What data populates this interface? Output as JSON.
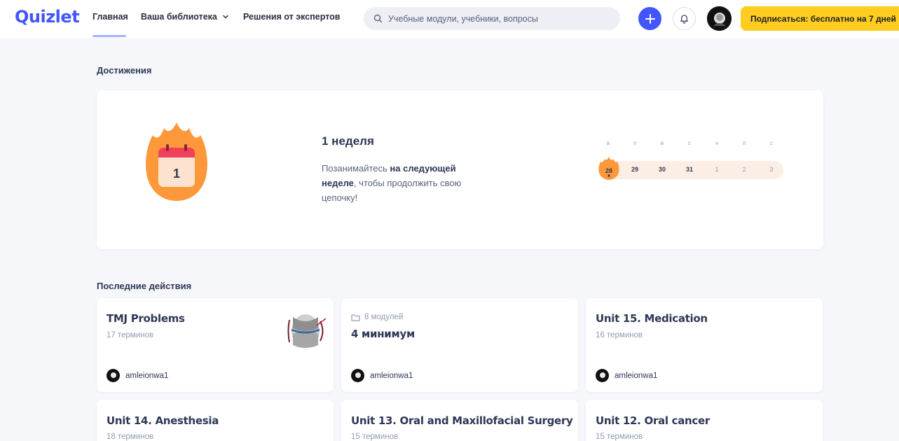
{
  "header": {
    "logo": "Quizlet",
    "nav": {
      "home": "Главная",
      "library": "Ваша библиотека",
      "experts": "Решения от экспертов"
    },
    "search": {
      "placeholder": "Учебные модули, учебники, вопросы"
    },
    "subscribe_label": "Подписаться: бесплатно на 7 дней",
    "accent_color": "#4255ff",
    "subscribe_color": "#ffcd1f"
  },
  "achievements": {
    "title": "Достижения",
    "badge_number": "1",
    "streak_title": "1 неделя",
    "streak_text": {
      "part1": "Позанимайтесь ",
      "bold": "на следующей неделе",
      "part2": ", чтобы продолжить свою цепочку!"
    },
    "weekdays": [
      "в",
      "п",
      "в",
      "с",
      "ч",
      "п",
      "с"
    ],
    "days": [
      "28",
      "29",
      "30",
      "31",
      "1",
      "2",
      "3"
    ]
  },
  "recent": {
    "title": "Последние действия",
    "cards": [
      {
        "title": "TMJ Problems",
        "terms": "17 терминов",
        "author": "amleionwa1"
      },
      {
        "folder": "8 модулей",
        "title": "4 минимум",
        "author": "amleionwa1"
      },
      {
        "title": "Unit 15. Medication",
        "terms": "16 терминов",
        "author": "amleionwa1"
      },
      {
        "title": "Unit 14. Anesthesia",
        "terms": "18 терминов"
      },
      {
        "title": "Unit 13. Oral and Maxillofacial Surgery",
        "terms": "15 терминов"
      },
      {
        "title": "Unit 12. Oral cancer",
        "terms": "15 терминов"
      }
    ]
  }
}
